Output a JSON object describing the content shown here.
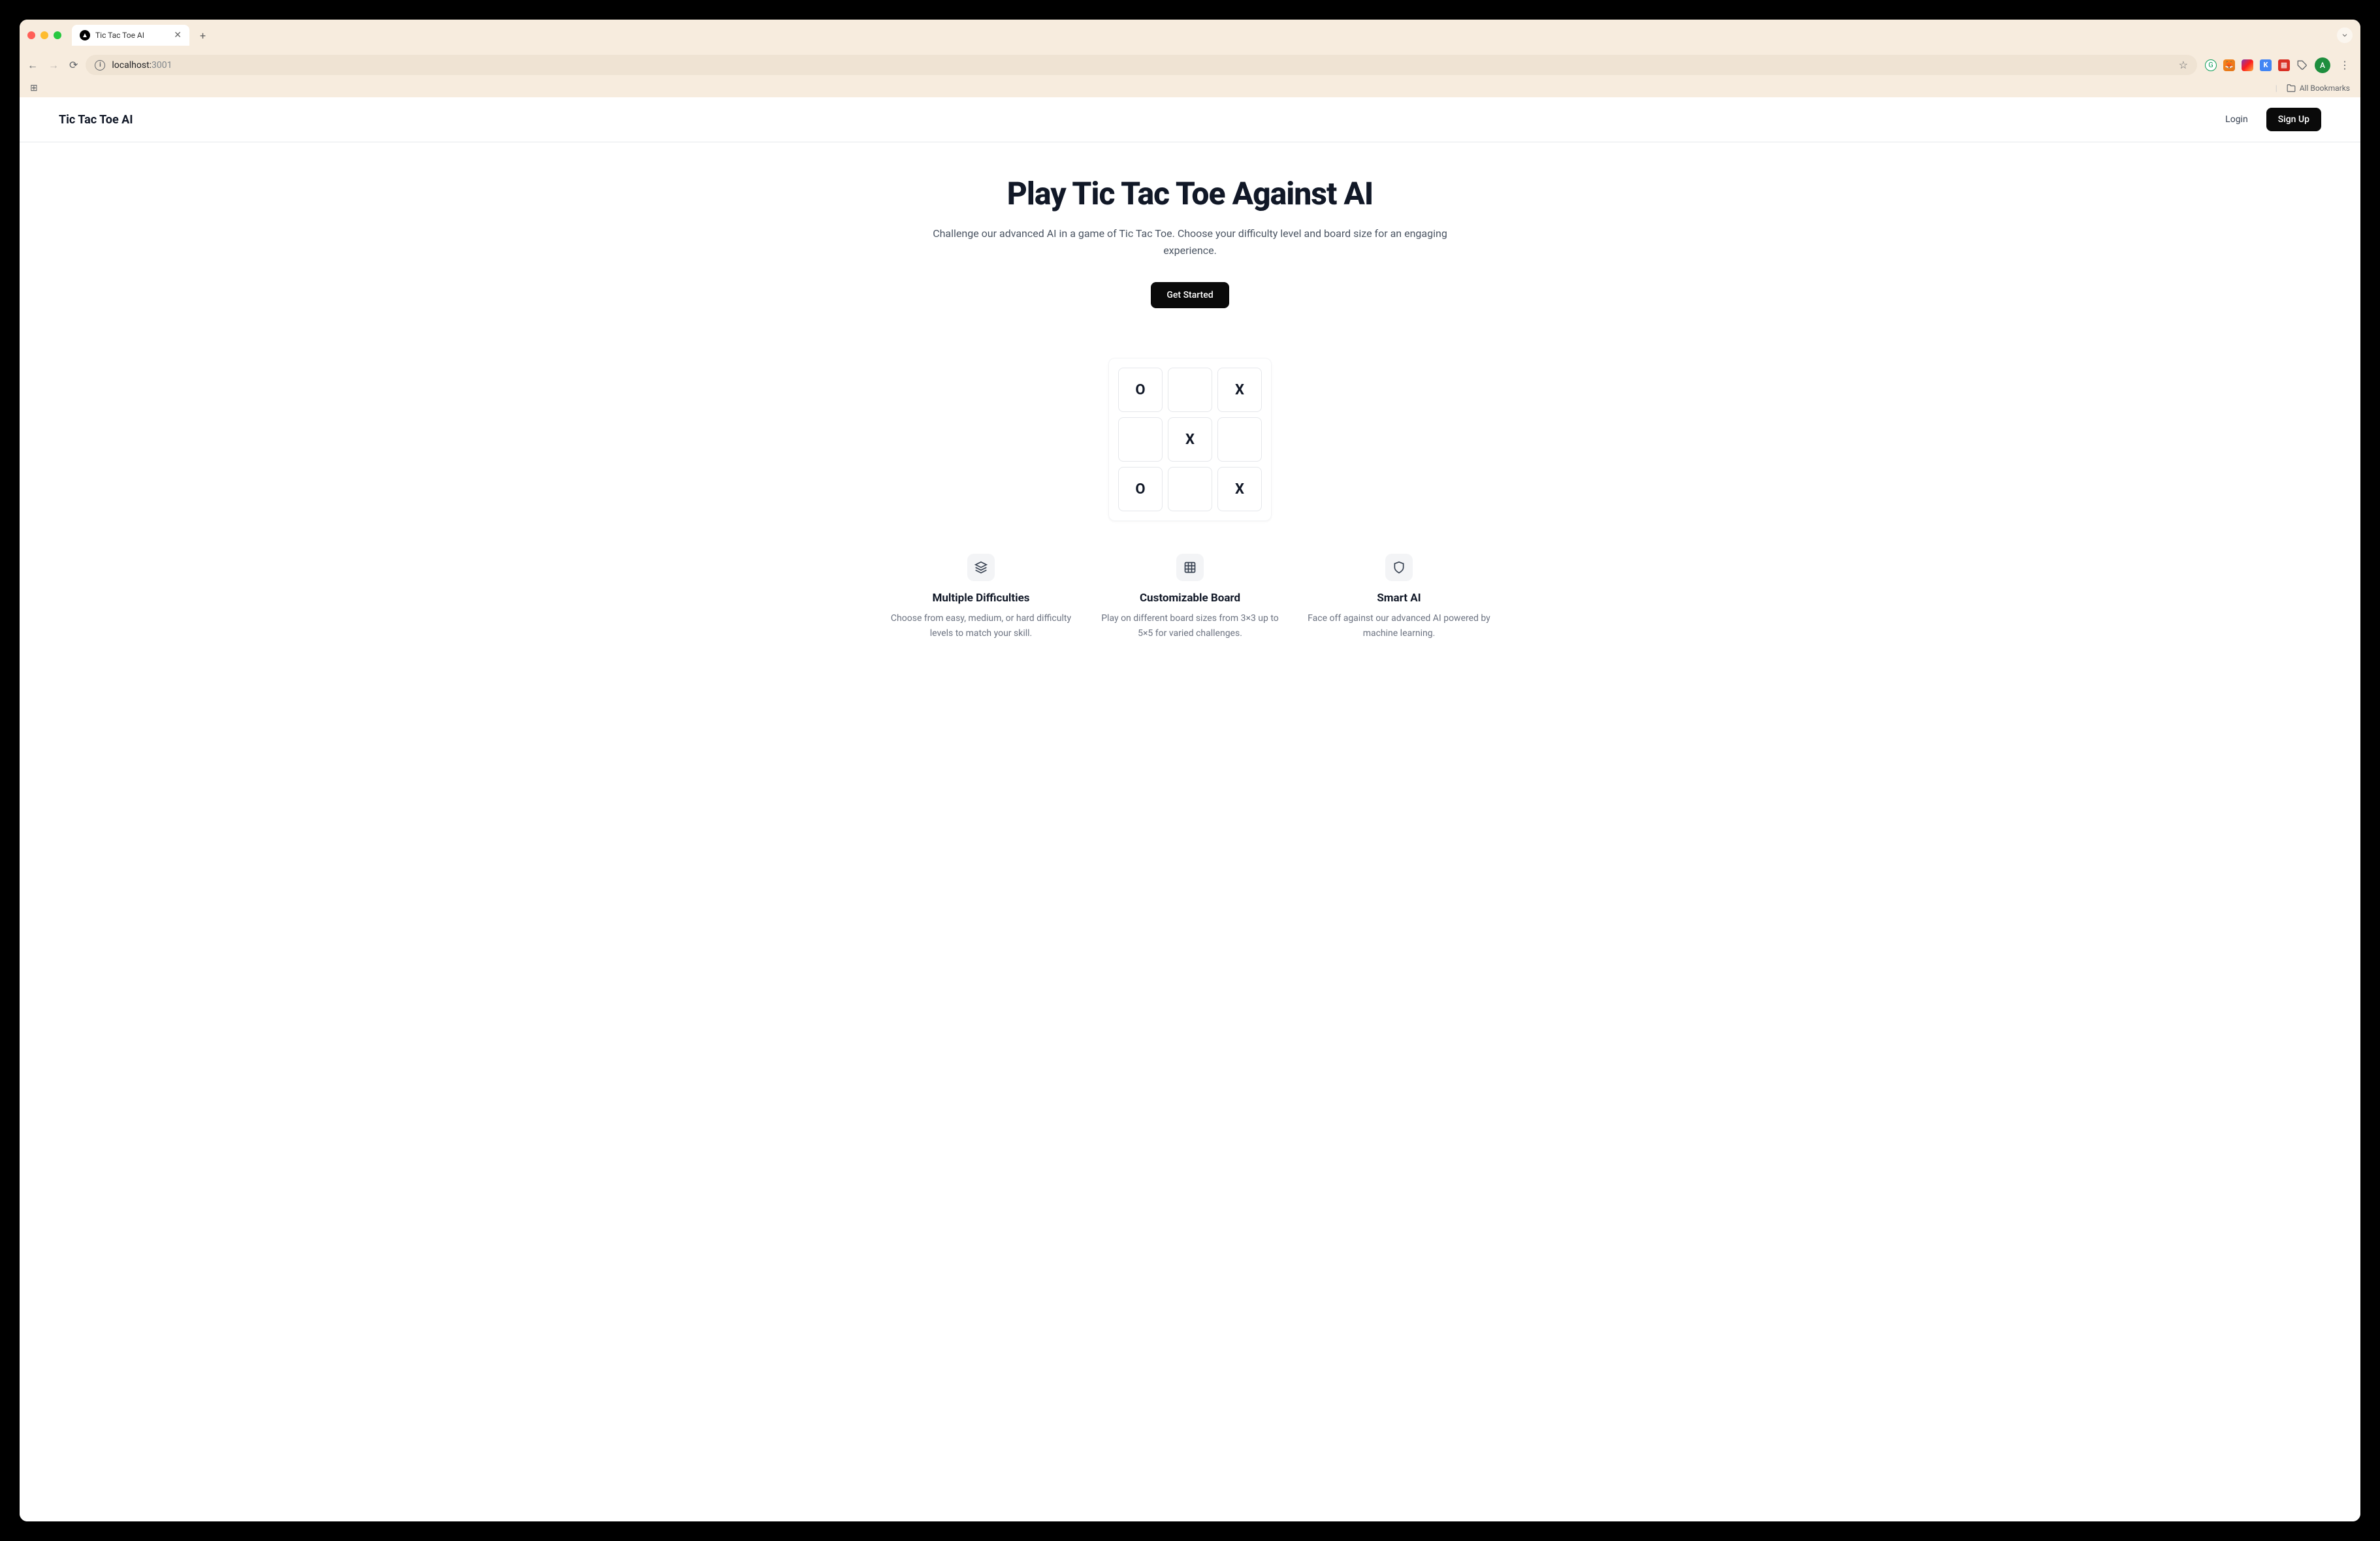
{
  "browser": {
    "tab_title": "Tic Tac Toe AI",
    "url_host": "localhost:",
    "url_port": "3001",
    "bookmarks_label": "All Bookmarks",
    "profile_initial": "A"
  },
  "header": {
    "logo": "Tic Tac Toe AI",
    "login_label": "Login",
    "signup_label": "Sign Up"
  },
  "hero": {
    "title": "Play Tic Tac Toe Against AI",
    "subtitle": "Challenge our advanced AI in a game of Tic Tac Toe. Choose your difficulty level and board size for an engaging experience.",
    "cta": "Get Started"
  },
  "board": {
    "cells": [
      "O",
      "",
      "X",
      "",
      "X",
      "",
      "O",
      "",
      "X"
    ]
  },
  "features": [
    {
      "title": "Multiple Difficulties",
      "desc": "Choose from easy, medium, or hard difficulty levels to match your skill."
    },
    {
      "title": "Customizable Board",
      "desc": "Play on different board sizes from 3×3 up to 5×5 for varied challenges."
    },
    {
      "title": "Smart AI",
      "desc": "Face off against our advanced AI powered by machine learning."
    }
  ]
}
